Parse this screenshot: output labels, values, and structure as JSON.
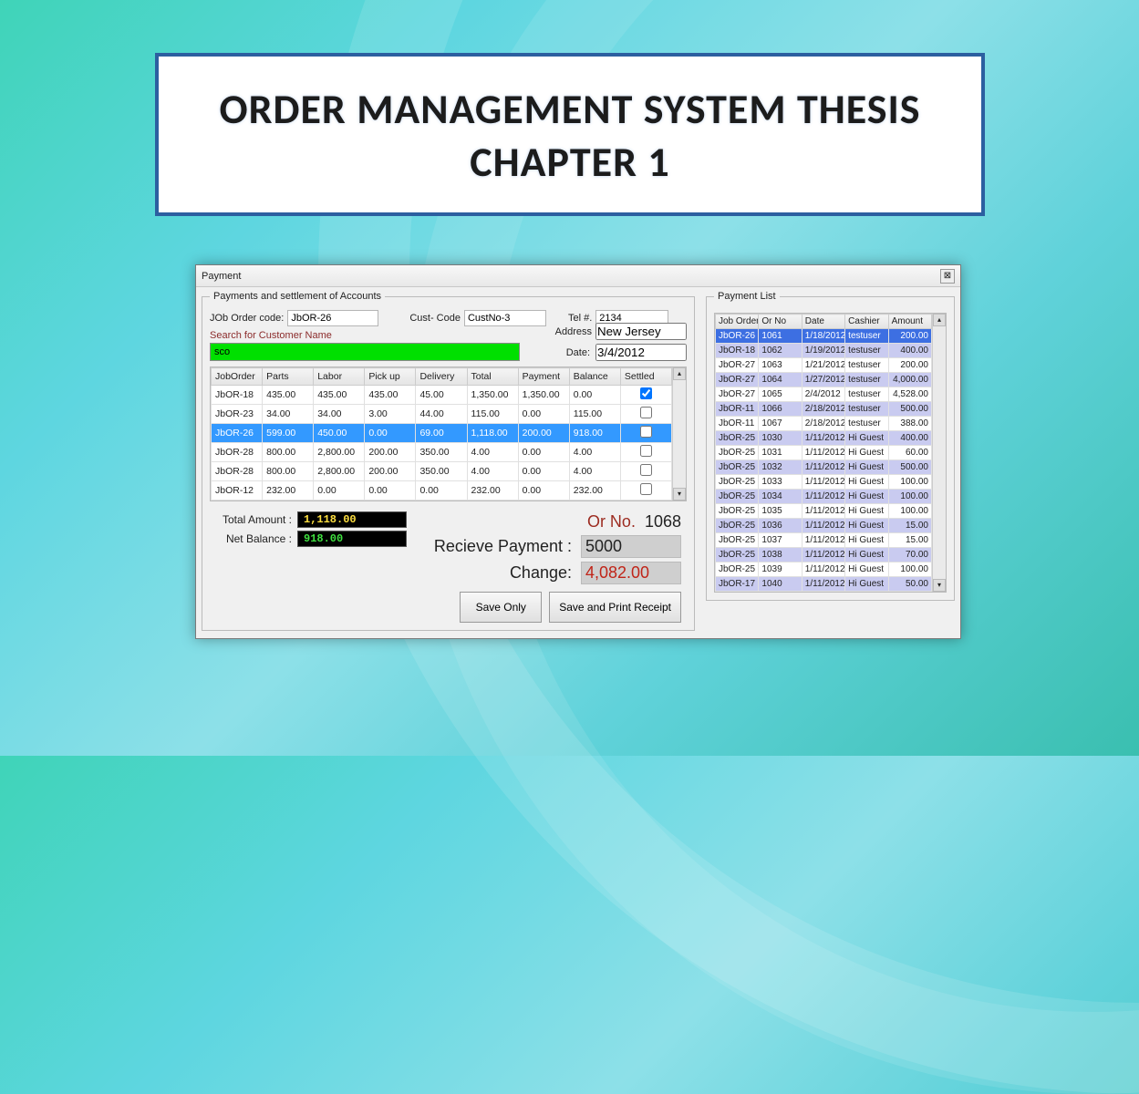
{
  "title": {
    "line1": "ORDER MANAGEMENT SYSTEM THESIS",
    "line2": "CHAPTER 1"
  },
  "window": {
    "title": "Payment",
    "close_glyph": "⊠",
    "left": {
      "legend": "Payments and settlement of Accounts",
      "labels": {
        "job_order_code": "JOb Order code:",
        "cust_code": "Cust- Code",
        "tel": "Tel #.",
        "search": "Search for Customer Name",
        "address": "Address",
        "date": "Date:"
      },
      "values": {
        "job_order_code": "JbOR-26",
        "cust_code": "CustNo-3",
        "tel": "2134",
        "search": "sco",
        "address": "New Jersey",
        "date": "3/4/2012"
      },
      "grid": {
        "headers": [
          "JobOrder",
          "Parts",
          "Labor",
          "Pick up",
          "Delivery",
          "Total",
          "Payment",
          "Balance",
          "Settled"
        ],
        "rows": [
          {
            "c": [
              "JbOR-18",
              "435.00",
              "435.00",
              "435.00",
              "45.00",
              "1,350.00",
              "1,350.00",
              "0.00"
            ],
            "settled": true
          },
          {
            "c": [
              "JbOR-23",
              "34.00",
              "34.00",
              "3.00",
              "44.00",
              "115.00",
              "0.00",
              "115.00"
            ],
            "settled": false
          },
          {
            "c": [
              "JbOR-26",
              "599.00",
              "450.00",
              "0.00",
              "69.00",
              "1,118.00",
              "200.00",
              "918.00"
            ],
            "settled": false,
            "sel": true
          },
          {
            "c": [
              "JbOR-28",
              "800.00",
              "2,800.00",
              "200.00",
              "350.00",
              "4.00",
              "0.00",
              "4.00"
            ],
            "settled": false
          },
          {
            "c": [
              "JbOR-28",
              "800.00",
              "2,800.00",
              "200.00",
              "350.00",
              "4.00",
              "0.00",
              "4.00"
            ],
            "settled": false
          },
          {
            "c": [
              "JbOR-12",
              "232.00",
              "0.00",
              "0.00",
              "0.00",
              "232.00",
              "0.00",
              "232.00"
            ],
            "settled": false
          }
        ]
      },
      "summary": {
        "total_label": "Total Amount :",
        "total_value": "1,118.00",
        "net_label": "Net Balance :",
        "net_value": "918.00",
        "or_label": "Or No.",
        "or_value": "1068",
        "recv_label": "Recieve Payment :",
        "recv_value": "5000",
        "change_label": "Change:",
        "change_value": "4,082.00"
      },
      "buttons": {
        "save_only": "Save Only",
        "save_print": "Save and Print Receipt"
      }
    },
    "right": {
      "legend": "Payment List",
      "headers": [
        "Job Order",
        "Or No",
        "Date",
        "Cashier",
        "Amount"
      ],
      "rows": [
        {
          "c": [
            "JbOR-26",
            "1061",
            "1/18/2012",
            "testuser",
            "200.00"
          ],
          "sel": true
        },
        {
          "c": [
            "JbOR-18",
            "1062",
            "1/19/2012",
            "testuser",
            "400.00"
          ],
          "alt": true
        },
        {
          "c": [
            "JbOR-27",
            "1063",
            "1/21/2012",
            "testuser",
            "200.00"
          ]
        },
        {
          "c": [
            "JbOR-27",
            "1064",
            "1/27/2012",
            "testuser",
            "4,000.00"
          ],
          "alt": true
        },
        {
          "c": [
            "JbOR-27",
            "1065",
            "2/4/2012",
            "testuser",
            "4,528.00"
          ]
        },
        {
          "c": [
            "JbOR-11",
            "1066",
            "2/18/2012",
            "testuser",
            "500.00"
          ],
          "alt": true
        },
        {
          "c": [
            "JbOR-11",
            "1067",
            "2/18/2012",
            "testuser",
            "388.00"
          ]
        },
        {
          "c": [
            "JbOR-25",
            "1030",
            "1/11/2012",
            "Hi Guest",
            "400.00"
          ],
          "alt": true
        },
        {
          "c": [
            "JbOR-25",
            "1031",
            "1/11/2012",
            "Hi Guest",
            "60.00"
          ]
        },
        {
          "c": [
            "JbOR-25",
            "1032",
            "1/11/2012",
            "Hi Guest",
            "500.00"
          ],
          "alt": true
        },
        {
          "c": [
            "JbOR-25",
            "1033",
            "1/11/2012",
            "Hi Guest",
            "100.00"
          ]
        },
        {
          "c": [
            "JbOR-25",
            "1034",
            "1/11/2012",
            "Hi Guest",
            "100.00"
          ],
          "alt": true
        },
        {
          "c": [
            "JbOR-25",
            "1035",
            "1/11/2012",
            "Hi Guest",
            "100.00"
          ]
        },
        {
          "c": [
            "JbOR-25",
            "1036",
            "1/11/2012",
            "Hi Guest",
            "15.00"
          ],
          "alt": true
        },
        {
          "c": [
            "JbOR-25",
            "1037",
            "1/11/2012",
            "Hi Guest",
            "15.00"
          ]
        },
        {
          "c": [
            "JbOR-25",
            "1038",
            "1/11/2012",
            "Hi Guest",
            "70.00"
          ],
          "alt": true
        },
        {
          "c": [
            "JbOR-25",
            "1039",
            "1/11/2012",
            "Hi Guest",
            "100.00"
          ]
        },
        {
          "c": [
            "JbOR-17",
            "1040",
            "1/11/2012",
            "Hi Guest",
            "50.00"
          ],
          "alt": true
        }
      ]
    }
  }
}
